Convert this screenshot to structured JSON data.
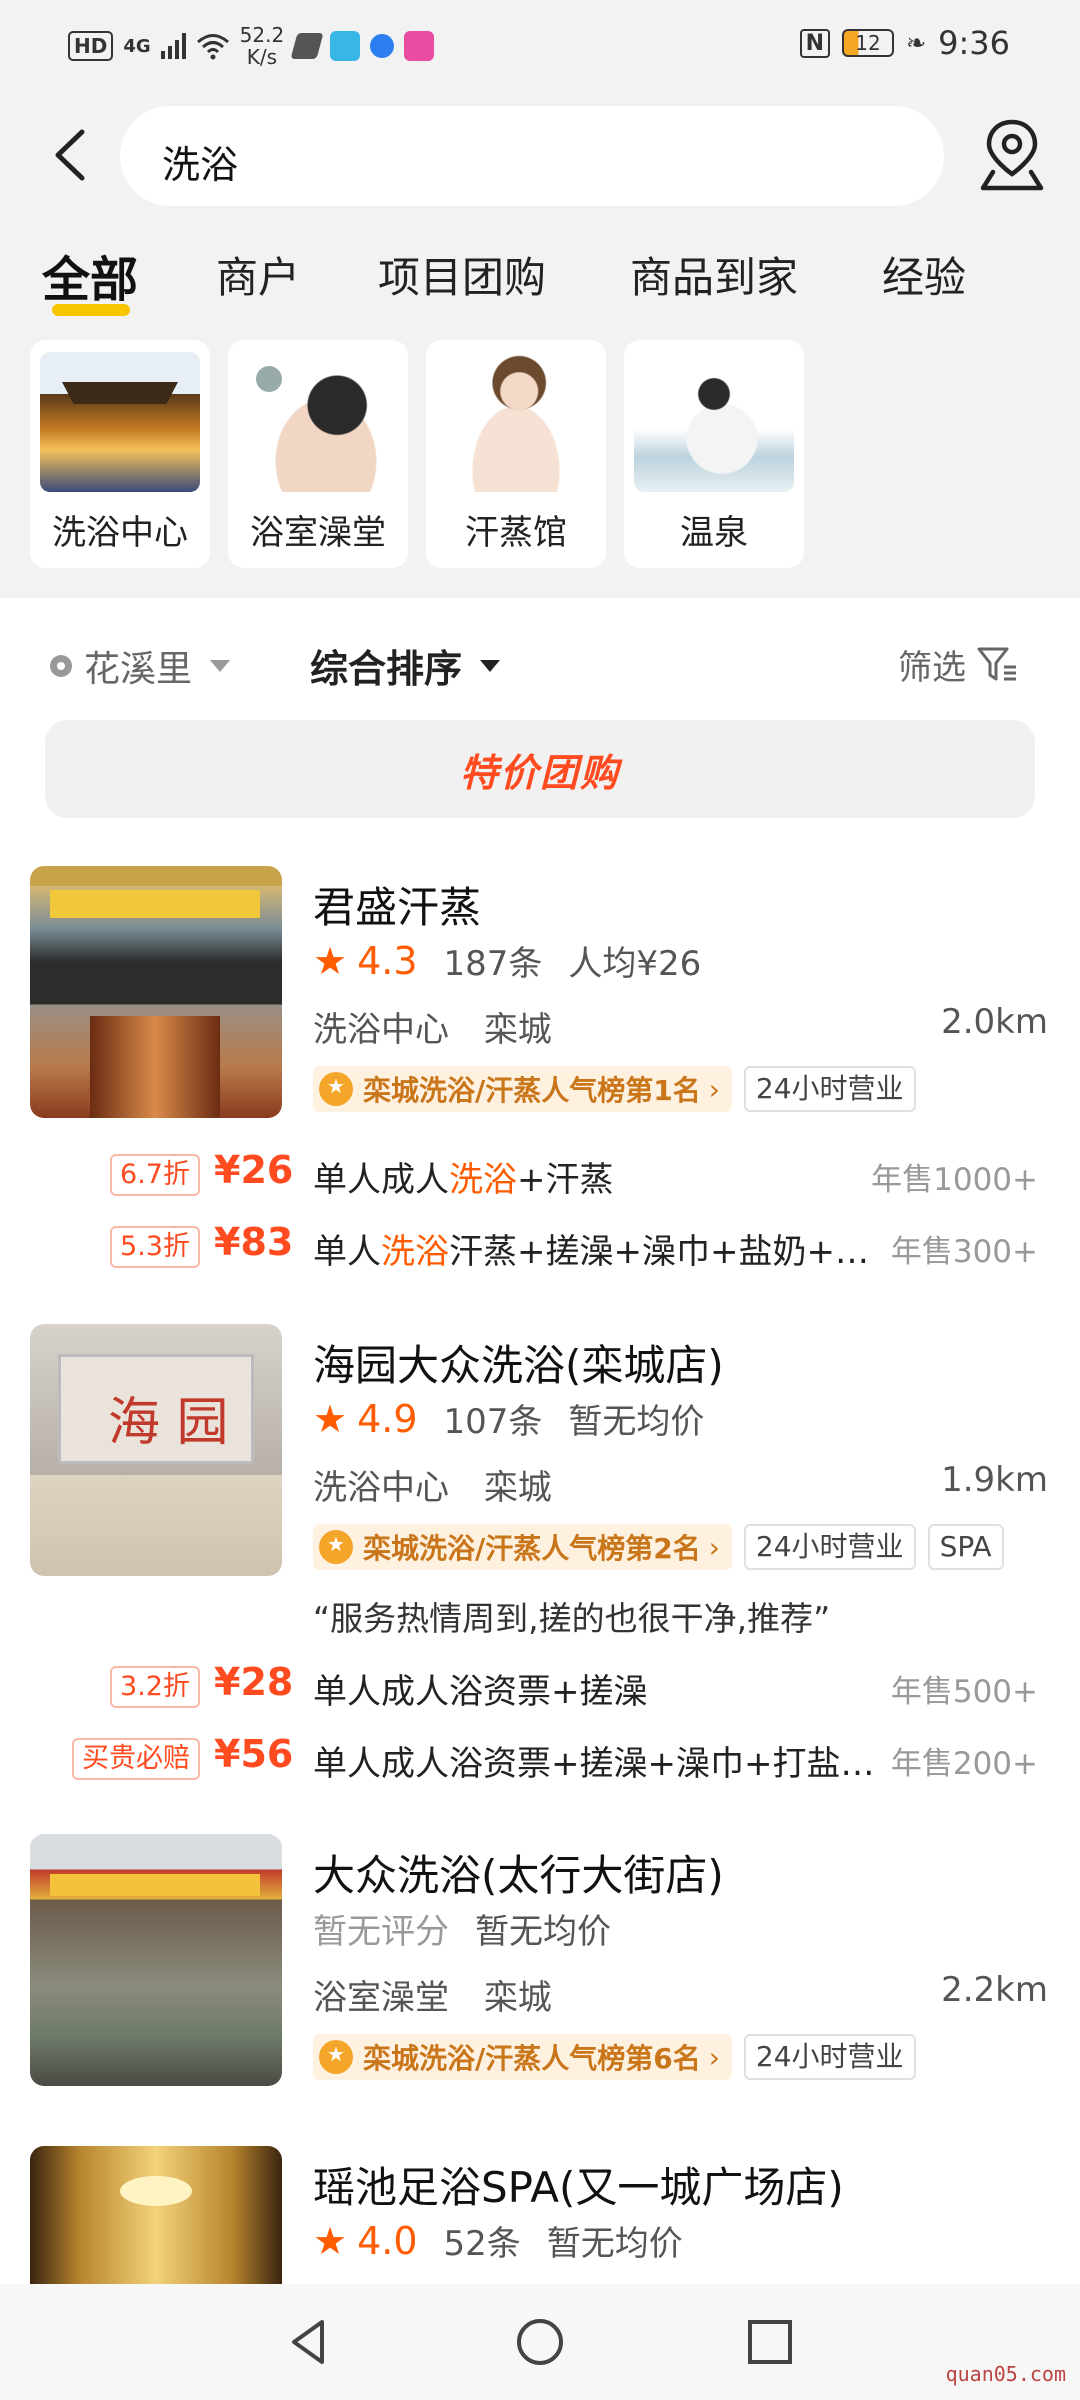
{
  "status_bar": {
    "hd": "HD",
    "network": "4G",
    "speed_value": "52.2",
    "speed_unit": "K/s",
    "nfc": "N",
    "battery": "12",
    "time": "9:36"
  },
  "search": {
    "query": "洗浴"
  },
  "tabs": [
    {
      "label": "全部"
    },
    {
      "label": "商户"
    },
    {
      "label": "项目团购"
    },
    {
      "label": "商品到家"
    },
    {
      "label": "经验"
    }
  ],
  "categories": [
    {
      "label": "洗浴中心"
    },
    {
      "label": "浴室澡堂"
    },
    {
      "label": "汗蒸馆"
    },
    {
      "label": "温泉"
    }
  ],
  "filters": {
    "location": "花溪里",
    "sort": "综合排序",
    "filter": "筛选"
  },
  "banner": {
    "label": "特价团购"
  },
  "listings": [
    {
      "title": "君盛汗蒸",
      "score": "4.3",
      "reviews": "187条",
      "avg_price": "人均¥26",
      "category": "洗浴中心",
      "area": "栾城",
      "distance": "2.0km",
      "rank_badge": "栾城洗浴/汗蒸人气榜第1名",
      "tags": [
        "24小时营业"
      ],
      "deals": [
        {
          "discount": "6.7折",
          "price": "¥26",
          "desc_parts": [
            "单人成人",
            "洗浴",
            "+汗蒸"
          ],
          "sales": "年售1000+"
        },
        {
          "discount": "5.3折",
          "price": "¥83",
          "desc_parts": [
            "单人",
            "洗浴",
            "汗蒸+搓澡+澡巾+盐奶+醋…"
          ],
          "sales": "年售300+"
        }
      ]
    },
    {
      "title": "海园大众洗浴(栾城店)",
      "score": "4.9",
      "reviews": "107条",
      "avg_price": "暂无均价",
      "category": "洗浴中心",
      "area": "栾城",
      "distance": "1.9km",
      "rank_badge": "栾城洗浴/汗蒸人气榜第2名",
      "tags": [
        "24小时营业",
        "SPA"
      ],
      "quote": "“服务热情周到,搓的也很干净,推荐”",
      "deals": [
        {
          "discount": "3.2折",
          "price": "¥28",
          "desc": "单人成人浴资票+搓澡",
          "sales": "年售500+"
        },
        {
          "discount": "买贵必赔",
          "price": "¥56",
          "desc": "单人成人浴资票+搓澡+澡巾+打盐+…",
          "sales": "年售200+"
        }
      ]
    },
    {
      "title": "大众洗浴(太行大街店)",
      "no_rating": "暂无评分",
      "avg_price": "暂无均价",
      "category": "浴室澡堂",
      "area": "栾城",
      "distance": "2.2km",
      "rank_badge": "栾城洗浴/汗蒸人气榜第6名",
      "tags": [
        "24小时营业"
      ]
    },
    {
      "title": "瑶池足浴SPA(又一城广场店)",
      "score": "4.0",
      "reviews": "52条",
      "avg_price": "暂无均价"
    }
  ],
  "watermark": "quan05.com",
  "colors": {
    "accent": "#ff5b00",
    "price": "#ff4b1f",
    "tab_underline": "#f7c600",
    "badge_bg": "#fff1e0",
    "badge_text": "#c9761a"
  }
}
